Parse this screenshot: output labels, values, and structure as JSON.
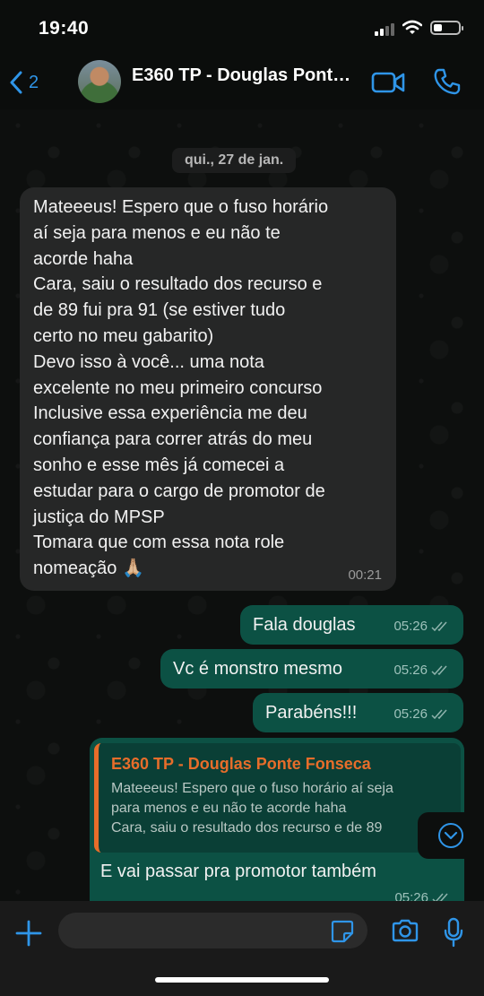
{
  "status_bar": {
    "time": "19:40"
  },
  "header": {
    "back_count": "2",
    "contact_name": "E360 TP - Douglas Ponte Fonseca"
  },
  "date_chip": "qui., 27 de jan.",
  "incoming_message": {
    "text": "Mateeeus! Espero que o fuso horário\naí seja para menos e eu não te\nacorde haha\nCara, saiu o resultado dos recurso e\nde 89 fui pra 91 (se estiver tudo\ncerto no meu gabarito)\nDevo isso à você... uma nota\nexcelente no meu primeiro concurso\nInclusive essa experiência me deu\nconfiança para correr atrás do meu\nsonho e esse mês já comecei a\nestudar para o cargo de promotor de\njustiça do MPSP\nTomara que com essa nota role\nnomeação 🙏🏼",
    "time": "00:21"
  },
  "outgoing_messages": [
    {
      "text": "Fala douglas",
      "time": "05:26"
    },
    {
      "text": "Vc é monstro mesmo",
      "time": "05:26"
    },
    {
      "text": "Parabéns!!!",
      "time": "05:26"
    }
  ],
  "reply_message": {
    "quoted_author": "E360 TP - Douglas Ponte Fonseca",
    "quoted_text": "Mateeeus! Espero que o fuso horário aí seja\npara menos e eu não te acorde haha\nCara, saiu o resultado dos recurso e de 89",
    "text": "E vai passar pra promotor também",
    "time": "05:26"
  },
  "input": {
    "placeholder": ""
  },
  "colors": {
    "accent": "#2f95e8",
    "outgoing_bubble": "#0c5144",
    "incoming_bubble": "#262727",
    "quote_author": "#e76d2a"
  },
  "icons": [
    "back-chevron-icon",
    "video-call-icon",
    "phone-icon",
    "scroll-down-icon",
    "plus-icon",
    "sticker-icon",
    "camera-icon",
    "microphone-icon"
  ]
}
